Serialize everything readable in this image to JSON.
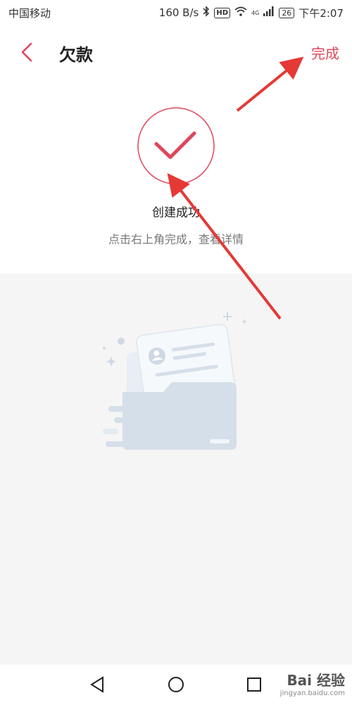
{
  "status": {
    "carrier": "中国移动",
    "speed": "160 B/s",
    "hd": "HD",
    "network": "4G",
    "battery": "26",
    "time": "下午2:07"
  },
  "header": {
    "title": "欠款",
    "done_label": "完成"
  },
  "success": {
    "title": "创建成功",
    "hint": "点击右上角完成，查看详情"
  },
  "watermark": {
    "brand": "Bai 经验",
    "site": "jingyan.baidu.com"
  },
  "colors": {
    "accent": "#e0475a",
    "arrow": "#e53935",
    "illustration": "#d5dfe9"
  },
  "icons": {
    "back": "chevron-left-icon",
    "success": "check-circle-icon",
    "empty": "empty-folder-illustration"
  }
}
